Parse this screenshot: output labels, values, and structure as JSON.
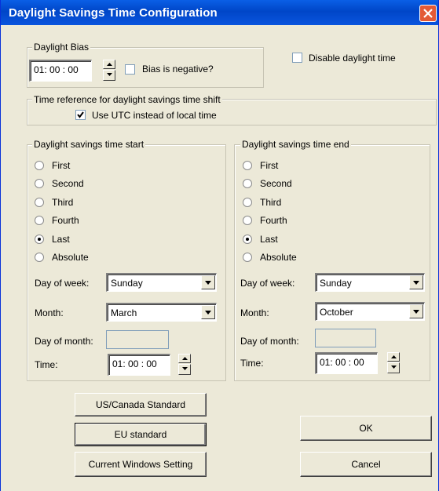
{
  "window": {
    "title": "Daylight Savings Time Configuration"
  },
  "bias": {
    "group_label": "Daylight Bias",
    "value": "01: 00 : 00",
    "negative_label": "Bias is negative?",
    "negative_checked": false
  },
  "disable_daylight": {
    "label": "Disable daylight time",
    "checked": false
  },
  "reference": {
    "group_label": "Time reference for daylight savings time shift",
    "use_utc_label": "Use UTC instead of local time",
    "use_utc_checked": true
  },
  "start": {
    "group_label": "Daylight savings time start",
    "options": [
      "First",
      "Second",
      "Third",
      "Fourth",
      "Last",
      "Absolute"
    ],
    "selected": "Last",
    "day_of_week_label": "Day of week:",
    "day_of_week": "Sunday",
    "month_label": "Month:",
    "month": "March",
    "day_of_month_label": "Day of month:",
    "day_of_month": "",
    "time_label": "Time:",
    "time": "01: 00 : 00"
  },
  "end": {
    "group_label": "Daylight savings time end",
    "options": [
      "First",
      "Second",
      "Third",
      "Fourth",
      "Last",
      "Absolute"
    ],
    "selected": "Last",
    "day_of_week_label": "Day of week:",
    "day_of_week": "Sunday",
    "month_label": "Month:",
    "month": "October",
    "day_of_month_label": "Day of month:",
    "day_of_month": "",
    "time_label": "Time:",
    "time": "01: 00 : 00"
  },
  "buttons": {
    "us_canada": "US/Canada Standard",
    "eu": "EU standard",
    "current_windows": "Current Windows Setting",
    "ok": "OK",
    "cancel": "Cancel"
  }
}
